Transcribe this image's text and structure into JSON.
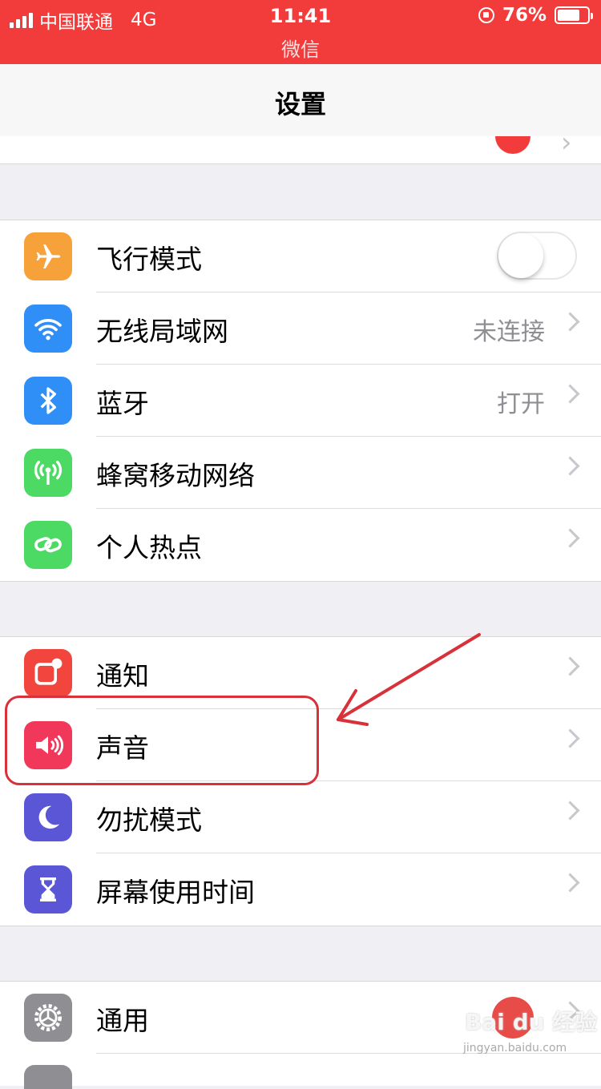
{
  "status_bar": {
    "carrier": "中国联通",
    "network": "4G",
    "time": "11:41",
    "sub_label": "微信",
    "battery": "76%",
    "battery_level": 0.76,
    "background_color": "#f23c3c"
  },
  "nav": {
    "title": "设置"
  },
  "groups": [
    {
      "items": [
        {
          "label": "飞行模式",
          "icon": "airplane-icon",
          "icon_color": "#f7a13b",
          "toggle": false
        },
        {
          "label": "无线局域网",
          "icon": "wifi-icon",
          "icon_color": "#2f8ff7",
          "value": "未连接"
        },
        {
          "label": "蓝牙",
          "icon": "bluetooth-icon",
          "icon_color": "#2f8ff7",
          "value": "打开"
        },
        {
          "label": "蜂窝移动网络",
          "icon": "cellular-icon",
          "icon_color": "#4cd964"
        },
        {
          "label": "个人热点",
          "icon": "hotspot-icon",
          "icon_color": "#4cd964"
        }
      ]
    },
    {
      "items": [
        {
          "label": "通知",
          "icon": "notification-icon",
          "icon_color": "#f2453d"
        },
        {
          "label": "声音",
          "icon": "speaker-icon",
          "icon_color": "#f2385a"
        },
        {
          "label": "勿扰模式",
          "icon": "moon-icon",
          "icon_color": "#5b56d6"
        },
        {
          "label": "屏幕使用时间",
          "icon": "hourglass-icon",
          "icon_color": "#5b56d6"
        }
      ]
    },
    {
      "items": [
        {
          "label": "通用",
          "icon": "gear-icon",
          "icon_color": "#8e8e93"
        }
      ]
    }
  ],
  "watermark": {
    "text": "Bai du 经验",
    "sub": "jingyan.baidu.com"
  }
}
